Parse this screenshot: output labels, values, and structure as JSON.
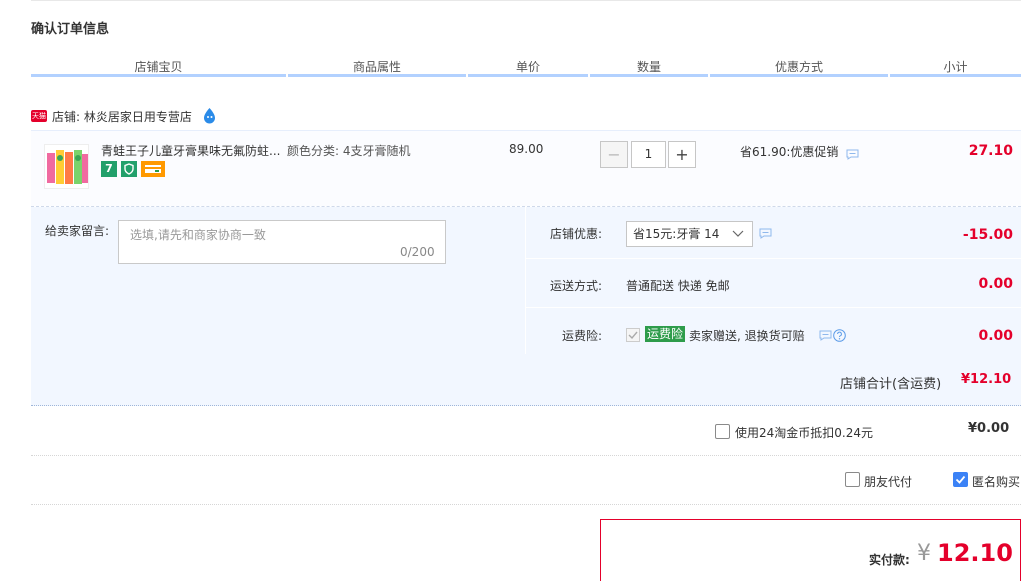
{
  "page_title": "确认订单信息",
  "columns": [
    "店铺宝贝",
    "商品属性",
    "单价",
    "数量",
    "优惠方式",
    "小计"
  ],
  "shop": {
    "badge": "天猫",
    "name": "店铺: 林炎居家日用专营店"
  },
  "item": {
    "title": "青蛙王子儿童牙膏果味无氟防蛀...",
    "service_7": "7",
    "sku": "颜色分类: 4支牙膏随机",
    "price": "89.00",
    "quantity": "1",
    "qty_minus": "−",
    "qty_plus": "+",
    "promo": "省61.90:优惠促销",
    "subtotal": "27.10"
  },
  "message": {
    "label": "给卖家留言:",
    "placeholder": "选填,请先和商家协商一致",
    "count": "0/200"
  },
  "options": {
    "coupon_label": "店铺优惠:",
    "coupon_value": "省15元:牙膏 14",
    "coupon_amount": "-15.00",
    "shipping_label": "运送方式:",
    "shipping_value": "普通配送 快递 免邮",
    "shipping_amount": "0.00",
    "insurance_label": "运费险:",
    "insurance_tag": "运费险",
    "insurance_text": "卖家赠送, 退换货可赔",
    "insurance_amount": "0.00"
  },
  "shop_total": {
    "label": "店铺合计(含运费)",
    "value": "¥12.10"
  },
  "coins": {
    "label": "使用24淘金币抵扣0.24元",
    "value": "¥0.00",
    "checked": false
  },
  "friend_pay": {
    "label": "朋友代付",
    "checked": false
  },
  "anonymous": {
    "label": "匿名购买",
    "checked": true
  },
  "payment": {
    "label": "实付款:",
    "currency": "¥",
    "value": "12.10"
  },
  "colors": {
    "accent_red": "#e4002b",
    "header_bar": "#b2d1ff",
    "panel_bg": "#f2f7ff",
    "checkbox_blue": "#3b82f6",
    "insurance_green": "#2e9c4b"
  }
}
